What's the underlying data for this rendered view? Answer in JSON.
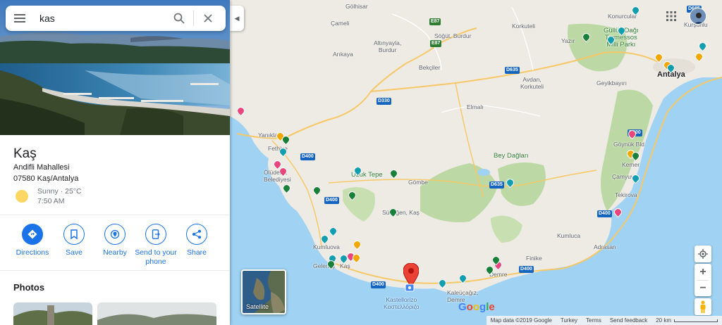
{
  "search": {
    "value": "kas",
    "placeholder": "Search Google Maps"
  },
  "place": {
    "title": "Kaş",
    "address_line1": "Andifli Mahallesi",
    "address_line2": "07580 Kaş/Antalya",
    "weather_condition": "Sunny · 25°C",
    "weather_time": "7:50 AM"
  },
  "actions": [
    {
      "label": "Directions",
      "icon": "directions-icon"
    },
    {
      "label": "Save",
      "icon": "bookmark-icon"
    },
    {
      "label": "Nearby",
      "icon": "nearby-icon"
    },
    {
      "label": "Send to your phone",
      "icon": "send-to-phone-icon"
    },
    {
      "label": "Share",
      "icon": "share-icon"
    }
  ],
  "photos": {
    "title": "Photos"
  },
  "map": {
    "labels": {
      "golhisar": "Gölhisar",
      "cameli": "Çameli",
      "altinyayla": "Altınyayla,\nBurdur",
      "arikaya": "Arıkaya",
      "sogut": "Söğüt, Burdur",
      "korkuteli": "Korkuteli",
      "korkuteli2": "Korkuteli",
      "bekciler": "Bekçiler",
      "avdan": "Avdan,\nKorkuteli",
      "yazir": "Yazır",
      "korucuk": "Konurcular",
      "gullukdagi": "Güllük Dağı\nTermessos\nMilli Parkı",
      "kurisi": "Kurşunlu",
      "antalya": "Antalya",
      "geyikbayiri": "Geyikbayırı",
      "elmali": "Elmalı",
      "yanikla": "Yanıkla",
      "fethiye": "Fethiye",
      "oludeniz": "Ölüdeniz\nBelediyesi",
      "beydaglari": "Bey Dağları",
      "uzuktepe": "Uzuk Tepe",
      "gombe": "Gömbe",
      "sutlegen": "Sütleğen, Kaş",
      "kumluova": "Kumluova",
      "gelemis": "Gelemiş",
      "kas": "Kaş",
      "kastellorizo": "Kastellorizo\nΚαστελλόριζο",
      "kalekoy": "Kaleüçağız,\nDemre",
      "demre": "Demre",
      "finike": "Finike",
      "kumluca": "Kumluca",
      "adrasan": "Adrasan",
      "tekirova": "Tekirova",
      "camyuva": "Çamyuva",
      "kemer": "Kemer",
      "goynuk": "Göynük Bld"
    },
    "roads": {
      "e87a": "E87",
      "e87b": "E87",
      "d635a": "D635",
      "d330": "D330",
      "d400a": "D400",
      "d400b": "D400",
      "d400c": "D400",
      "d635b": "D635",
      "d400d": "D400",
      "d400e": "D400",
      "d400f": "D400",
      "d685": "D685"
    },
    "satellite_label": "Satellite",
    "google_logo": "Google",
    "attribution": {
      "map_data": "Map data ©2019 Google",
      "region": "Turkey",
      "terms": "Terms",
      "feedback": "Send feedback",
      "scale": "20 km"
    }
  },
  "colors": {
    "accent": "#1a73e8",
    "water": "#aadaff",
    "land": "#f1efe9",
    "park": "#b8d8a0"
  }
}
